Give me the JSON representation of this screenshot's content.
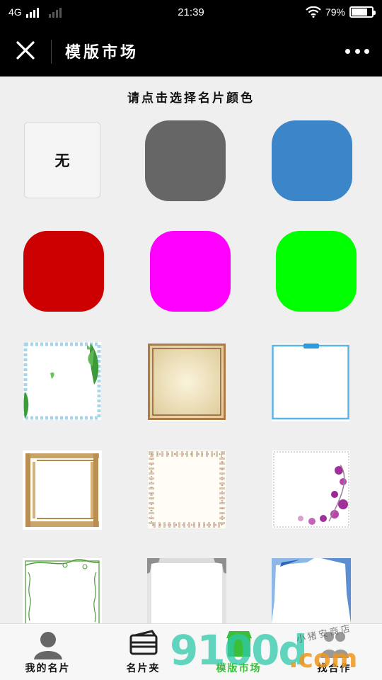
{
  "status_bar": {
    "network": "4G",
    "time": "21:39",
    "battery": "79%",
    "battery_level": 0.79
  },
  "title_bar": {
    "title": "模版市场"
  },
  "content": {
    "prompt": "请点击选择名片颜色",
    "colors": [
      {
        "label": "无",
        "color": "#f5f5f5"
      },
      {
        "color": "#666666"
      },
      {
        "color": "#3b86c8"
      },
      {
        "color": "#cc0000"
      },
      {
        "color": "#ff00ff"
      },
      {
        "color": "#00ff00"
      }
    ],
    "frames": [
      {
        "style": "leaf-blue-stripe"
      },
      {
        "style": "beige-parchment"
      },
      {
        "style": "blue-line-clip"
      },
      {
        "style": "bamboo"
      },
      {
        "style": "floral-border"
      },
      {
        "style": "purple-orchid"
      },
      {
        "style": "green-vine"
      },
      {
        "style": "silver-corners"
      },
      {
        "style": "blue-corners"
      }
    ]
  },
  "bottom_nav": {
    "items": [
      {
        "label": "我的名片",
        "icon": "person-icon"
      },
      {
        "label": "名片夹",
        "icon": "card-holder-icon"
      },
      {
        "label": "模版市场",
        "icon": "store-icon",
        "active": true
      },
      {
        "label": "找合作",
        "icon": "partners-icon"
      }
    ],
    "active_color": "#3bbf3b"
  },
  "watermark": {
    "text": "9100d",
    "suffix": ".com",
    "small": "小猪安商店"
  }
}
